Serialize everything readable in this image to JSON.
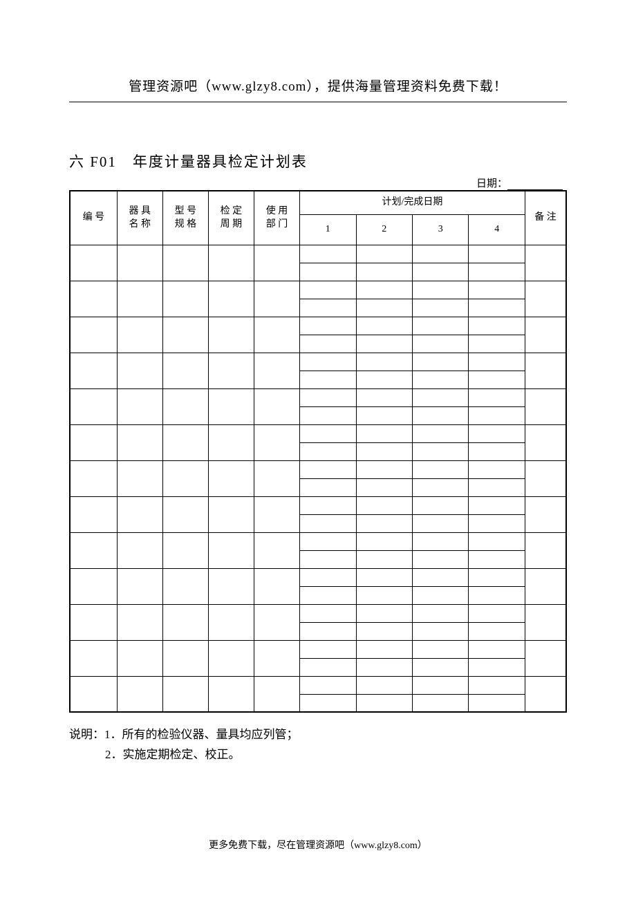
{
  "header": "管理资源吧（www.glzy8.com），提供海量管理资料免费下载！",
  "title": "六 F01　年度计量器具检定计划表",
  "date_label": "日期：",
  "columns": {
    "num": "编 号",
    "name": "器 具\n名 称",
    "spec": "型 号\n规 格",
    "cycle": "检 定\n周 期",
    "dept": "使 用\n部 门",
    "plan_header": "计划/完成日期",
    "q1": "1",
    "q2": "2",
    "q3": "3",
    "q4": "4",
    "note": "备 注"
  },
  "row_count": 13,
  "notes": {
    "label": "说明：",
    "line1": "1．所有的检验仪器、量具均应列管；",
    "line2": "2．实施定期检定、校正。"
  },
  "footer": "更多免费下载，尽在管理资源吧（www.glzy8.com）"
}
